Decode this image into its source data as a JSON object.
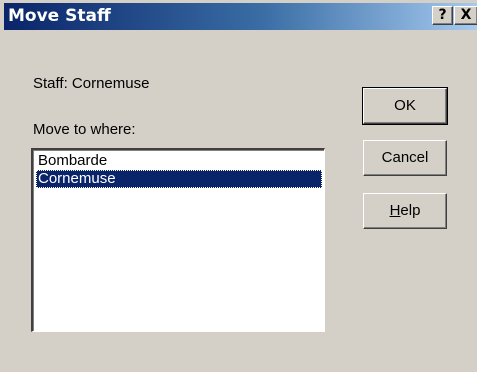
{
  "window": {
    "title": "Move Staff",
    "help_glyph": "?",
    "close_glyph": "X"
  },
  "dialog": {
    "staff_label": "Staff:  Cornemuse",
    "move_label": "Move to where:"
  },
  "listbox": {
    "items": [
      {
        "label": "Bombarde",
        "selected": false
      },
      {
        "label": "Cornemuse",
        "selected": true
      }
    ]
  },
  "buttons": {
    "ok": "OK",
    "cancel": "Cancel",
    "help_mnemonic": "H",
    "help_rest": "elp"
  },
  "colors": {
    "title_bar": "#0a246a",
    "face": "#d4d0c8",
    "selection": "#0a246a"
  }
}
